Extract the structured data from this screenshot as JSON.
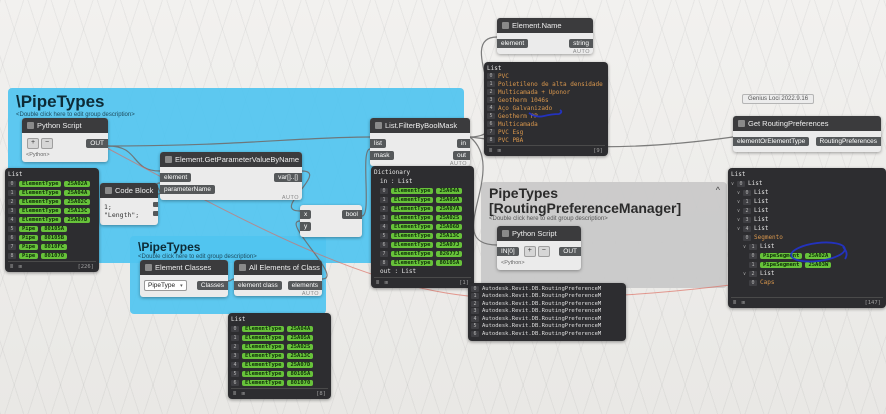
{
  "groups": {
    "g1": {
      "title": "\\PipeTypes",
      "sub": "<Double click here to edit group description>"
    },
    "g2": {
      "title": "\\PipeTypes",
      "sub": "<Double click here to edit group description>"
    },
    "g3": {
      "title": "PipeTypes",
      "title2": "[RoutingPreferenceManager]",
      "sub": "<Double click here to edit group description>",
      "collapse": "^"
    }
  },
  "nodes": {
    "python1": {
      "title": "Python Script",
      "btn_plus": "+",
      "btn_minus": "−",
      "out": "OUT",
      "lang": "<Python>"
    },
    "codeblock": {
      "title": "Code Block",
      "line1": "1;",
      "line2": "\"Length\";"
    },
    "getparam": {
      "title": "Element.GetParameterValueByName",
      "in1": "element",
      "in2": "parameterName",
      "out": "var[]..[]",
      "auto": "AUTO"
    },
    "filtermask": {
      "title": "List.FilterByBoolMask",
      "in1": "list",
      "in2": "mask",
      "out1": "in",
      "out2": "out",
      "auto": "AUTO"
    },
    "eq": {
      "in1": "x",
      "in2": "y",
      "out": "bool"
    },
    "elemname": {
      "title": "Element.Name",
      "in1": "element",
      "out": "string",
      "auto": "AUTO"
    },
    "elemclasses": {
      "title": "Element Classes",
      "dropdown": "PipeType",
      "caret": "▾",
      "out": "Classes"
    },
    "allelements": {
      "title": "All Elements of Class",
      "in1": "element class",
      "out": "elements",
      "auto": "AUTO"
    },
    "python2": {
      "title": "Python Script",
      "in1": "IN[0]",
      "btn_plus": "+",
      "btn_minus": "−",
      "out": "OUT",
      "lang": "<Python>"
    },
    "getrouting": {
      "title": "Get RoutingPreferences",
      "in1": "elementOrElementType",
      "out": "RoutingPreferences",
      "badge": "Genius Loci 2022.9.16"
    }
  },
  "watches": {
    "left": {
      "rows": [
        {
          "t": "List"
        },
        {
          "i": "0",
          "badge": "ElementType",
          "id": "25A02A"
        },
        {
          "i": "1",
          "badge": "ElementType",
          "id": "25A04A"
        },
        {
          "i": "2",
          "badge": "ElementType",
          "id": "25A02C"
        },
        {
          "i": "3",
          "badge": "ElementType",
          "id": "25A13C"
        },
        {
          "i": "4",
          "badge": "ElementType",
          "id": "25A07D"
        },
        {
          "i": "5",
          "badge": "Pipe",
          "id": "80105A"
        },
        {
          "i": "6",
          "badge": "Pipe",
          "id": "80105B"
        },
        {
          "i": "7",
          "badge": "Pipe",
          "id": "8010FC"
        },
        {
          "i": "8",
          "badge": "Pipe",
          "id": "801070"
        }
      ],
      "footer": "[226]"
    },
    "dict": {
      "rows": [
        {
          "t": "Dictionary"
        },
        {
          "t": "in : List",
          "indent": 1
        },
        {
          "i": "0",
          "badge": "ElementType",
          "id": "25A04A",
          "indent": 1
        },
        {
          "i": "1",
          "badge": "ElementType",
          "id": "25A05A",
          "indent": 1
        },
        {
          "i": "2",
          "badge": "ElementType",
          "id": "25A07A",
          "indent": 1
        },
        {
          "i": "3",
          "badge": "ElementType",
          "id": "25A02S",
          "indent": 1
        },
        {
          "i": "4",
          "badge": "ElementType",
          "id": "25A06D",
          "indent": 1
        },
        {
          "i": "5",
          "badge": "ElementType",
          "id": "25A13C",
          "indent": 1
        },
        {
          "i": "6",
          "badge": "ElementType",
          "id": "25A07J",
          "indent": 1
        },
        {
          "i": "7",
          "badge": "ElementType",
          "id": "82677J",
          "indent": 1
        },
        {
          "i": "8",
          "badge": "ElementType",
          "id": "80105A",
          "indent": 1
        },
        {
          "t": "out : List",
          "indent": 1
        }
      ],
      "footer": "[1]"
    },
    "topright": {
      "rows": [
        {
          "t": "List"
        },
        {
          "i": "0",
          "str": "PVC"
        },
        {
          "i": "1",
          "str": "Polietileno de alta densidade"
        },
        {
          "i": "2",
          "str": "Multicamada + Uponor"
        },
        {
          "i": "3",
          "str": "Geotherm 1046s"
        },
        {
          "i": "4",
          "str": "Aço Galvanizado"
        },
        {
          "i": "5",
          "str": "Geotherm PP"
        },
        {
          "i": "6",
          "str": "Multicamada"
        },
        {
          "i": "7",
          "str": "PVC Esg"
        },
        {
          "i": "8",
          "str": "PVC PBA"
        }
      ],
      "footer": "[9]"
    },
    "bottommid": {
      "rows": [
        {
          "t": "List"
        },
        {
          "i": "0",
          "badge": "ElementType",
          "id": "25A04A"
        },
        {
          "i": "1",
          "badge": "ElementType",
          "id": "25A05A"
        },
        {
          "i": "2",
          "badge": "ElementType",
          "id": "25A02S"
        },
        {
          "i": "3",
          "badge": "ElementType",
          "id": "25A13C"
        },
        {
          "i": "4",
          "badge": "ElementType",
          "id": "25A07D"
        },
        {
          "i": "5",
          "badge": "ElementType",
          "id": "80105A"
        },
        {
          "i": "6",
          "badge": "ElementType",
          "id": "801070"
        }
      ],
      "footer": "[8]"
    },
    "routingstr": {
      "rows": [
        {
          "i": "0",
          "w": "Autodesk.Revit.DB.RoutingPreferenceM"
        },
        {
          "i": "1",
          "w": "Autodesk.Revit.DB.RoutingPreferenceM"
        },
        {
          "i": "2",
          "w": "Autodesk.Revit.DB.RoutingPreferenceM"
        },
        {
          "i": "3",
          "w": "Autodesk.Revit.DB.RoutingPreferenceM"
        },
        {
          "i": "4",
          "w": "Autodesk.Revit.DB.RoutingPreferenceM"
        },
        {
          "i": "5",
          "w": "Autodesk.Revit.DB.RoutingPreferenceM"
        },
        {
          "i": "6",
          "w": "Autodesk.Revit.DB.RoutingPreferenceM"
        }
      ]
    },
    "right": {
      "rows": [
        {
          "t": "List"
        },
        {
          "arrow": "∨",
          "i": "0",
          "t": "List"
        },
        {
          "arrow": "∨",
          "i": "0",
          "t": "List",
          "indent": 1
        },
        {
          "arrow": "∨",
          "i": "1",
          "t": "List",
          "indent": 1
        },
        {
          "arrow": "∨",
          "i": "2",
          "t": "List",
          "indent": 1
        },
        {
          "arrow": "∨",
          "i": "3",
          "t": "List",
          "indent": 1
        },
        {
          "arrow": "∨",
          "i": "4",
          "t": "List",
          "indent": 1
        },
        {
          "i": "0",
          "str": "Segmento",
          "indent": 2
        },
        {
          "arrow": "∨",
          "i": "1",
          "t": "List",
          "indent": 2
        },
        {
          "i": "0",
          "badge": "PipeSegment",
          "id": "25A02A",
          "indent": 3
        },
        {
          "i": "1",
          "badge": "PipeSegment",
          "id": "25A03W",
          "indent": 3
        },
        {
          "arrow": "∨",
          "i": "2",
          "t": "List",
          "indent": 2
        },
        {
          "i": "0",
          "str": "Caps",
          "indent": 3
        }
      ],
      "footer": "[147]"
    }
  }
}
